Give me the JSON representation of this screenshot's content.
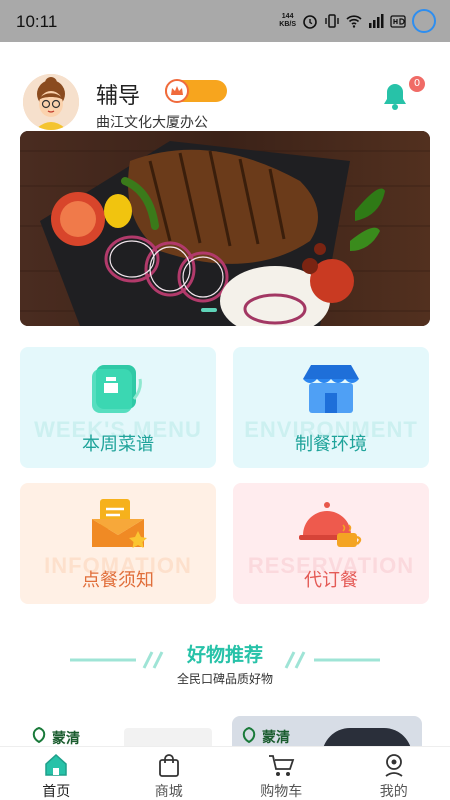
{
  "status_bar": {
    "time": "10:11",
    "net_speed_top": "144",
    "net_speed_bottom": "KB/S"
  },
  "header": {
    "user_name": "辅导",
    "location": "曲江文化大厦办公",
    "notification_count": "0"
  },
  "cards": [
    {
      "ghost": "WEEK'S MENU",
      "label": "本周菜谱",
      "icon": "menu-book-icon"
    },
    {
      "ghost": "ENVIRONMENT",
      "label": "制餐环境",
      "icon": "storefront-icon"
    },
    {
      "ghost": "INFOMATION",
      "label": "点餐须知",
      "icon": "envelope-star-icon"
    },
    {
      "ghost": "RESERVATION",
      "label": "代订餐",
      "icon": "cloche-icon"
    }
  ],
  "section": {
    "title": "好物推荐",
    "subtitle": "全民口碑品质好物"
  },
  "products": [
    {
      "brand": "蒙清"
    },
    {
      "brand": "蒙清"
    }
  ],
  "bottom_nav": [
    {
      "label": "首页",
      "icon": "home-icon"
    },
    {
      "label": "商城",
      "icon": "shopping-bag-icon"
    },
    {
      "label": "购物车",
      "icon": "cart-icon"
    },
    {
      "label": "我的",
      "icon": "profile-icon"
    }
  ],
  "colors": {
    "accent": "#27c2a8",
    "status_bar": "#a9a9a9",
    "vip": "#f7a51e",
    "badge": "#f06b66"
  }
}
